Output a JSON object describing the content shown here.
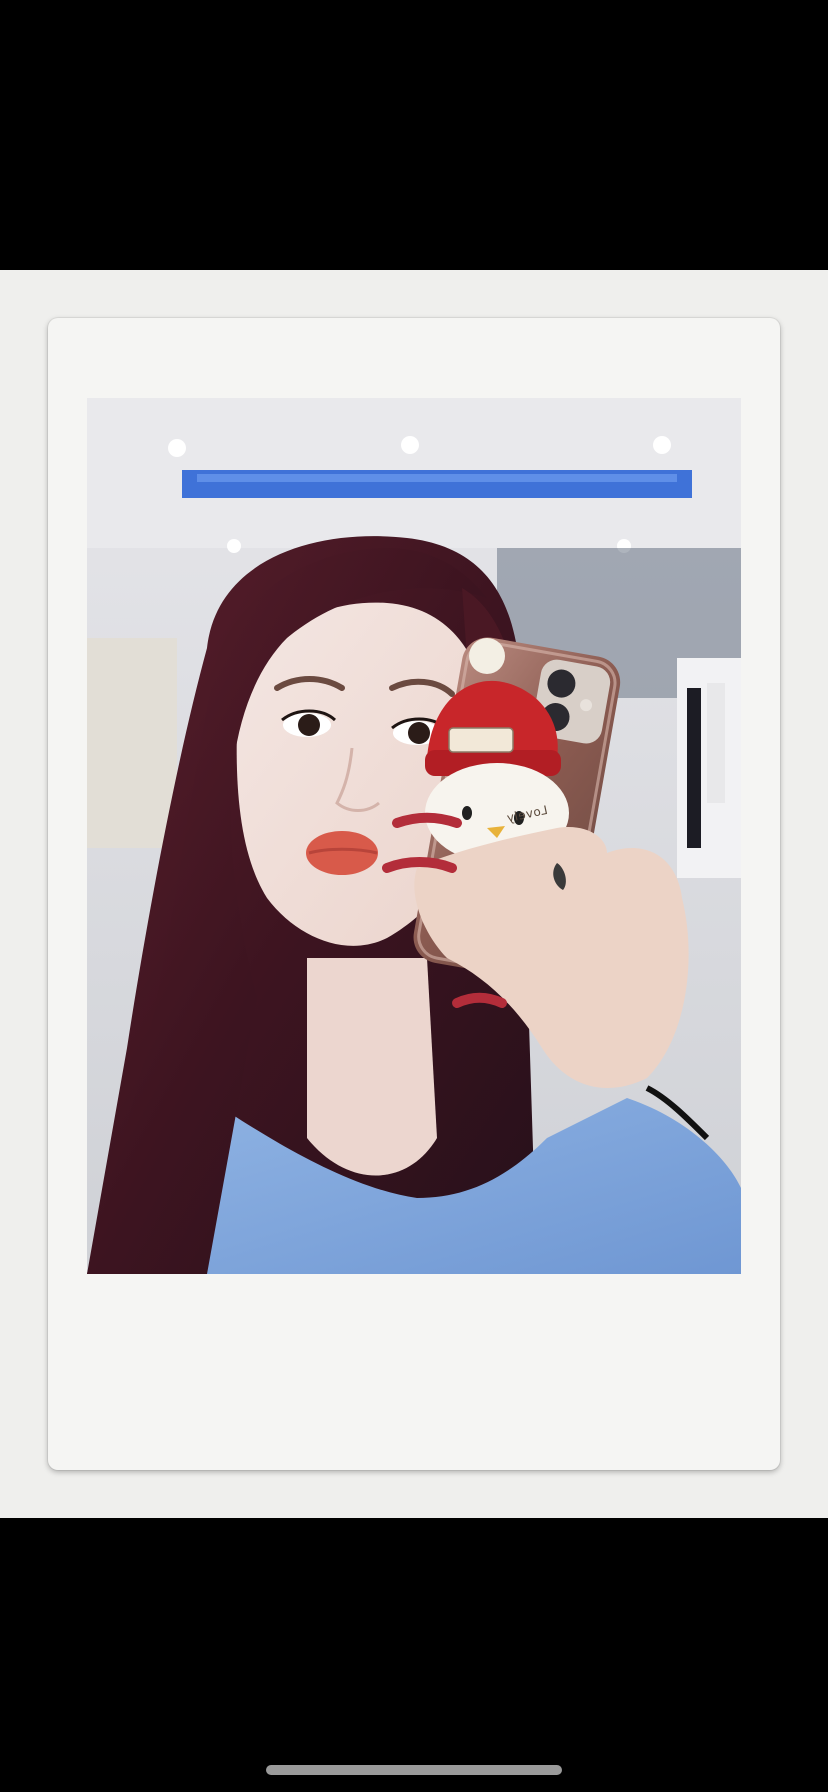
{
  "viewer": {
    "background_color": "#000000",
    "frame_color": "#f5f5f3"
  },
  "photo": {
    "phone_case_tag": "Lovely"
  },
  "home_indicator": {
    "color": "#9a9a9a"
  }
}
